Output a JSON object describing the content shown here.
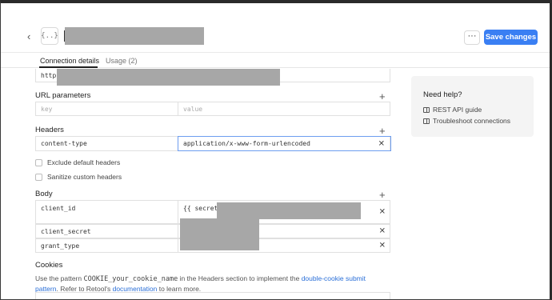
{
  "header": {
    "back_icon": "chevron-left-icon",
    "resource_icon": "{..}",
    "more_label": "···",
    "save_label": "Save changes"
  },
  "tabs": [
    {
      "label": "Connection details",
      "active": true
    },
    {
      "label": "Usage (2)",
      "active": false
    }
  ],
  "base_url": {
    "prefix": "https"
  },
  "url_parameters": {
    "title": "URL parameters",
    "key_placeholder": "key",
    "value_placeholder": "value"
  },
  "headers": {
    "title": "Headers",
    "rows": [
      {
        "key": "content-type",
        "value": "application/x-www-form-urlencoded"
      }
    ],
    "exclude_default_label": "Exclude default headers",
    "sanitize_label": "Sanitize custom headers"
  },
  "body": {
    "title": "Body",
    "rows": [
      {
        "key": "client_id",
        "value_prefix": "{{ secrets"
      },
      {
        "key": "client_secret"
      },
      {
        "key": "grant_type"
      }
    ]
  },
  "cookies": {
    "title": "Cookies",
    "text_1": "Use the pattern ",
    "code": "COOKIE_your_cookie_name",
    "text_2": " in the Headers section to implement the ",
    "link_1": "double-cookie submit pattern",
    "text_3": ". Refer to Retool's ",
    "link_2": "documentation",
    "text_4": " to learn more."
  },
  "help": {
    "title": "Need help?",
    "links": [
      "REST API guide",
      "Troubleshoot connections"
    ]
  },
  "colors": {
    "accent": "#3a7ff3",
    "link": "#2a6fd8",
    "redaction": "#a7a7a7"
  }
}
